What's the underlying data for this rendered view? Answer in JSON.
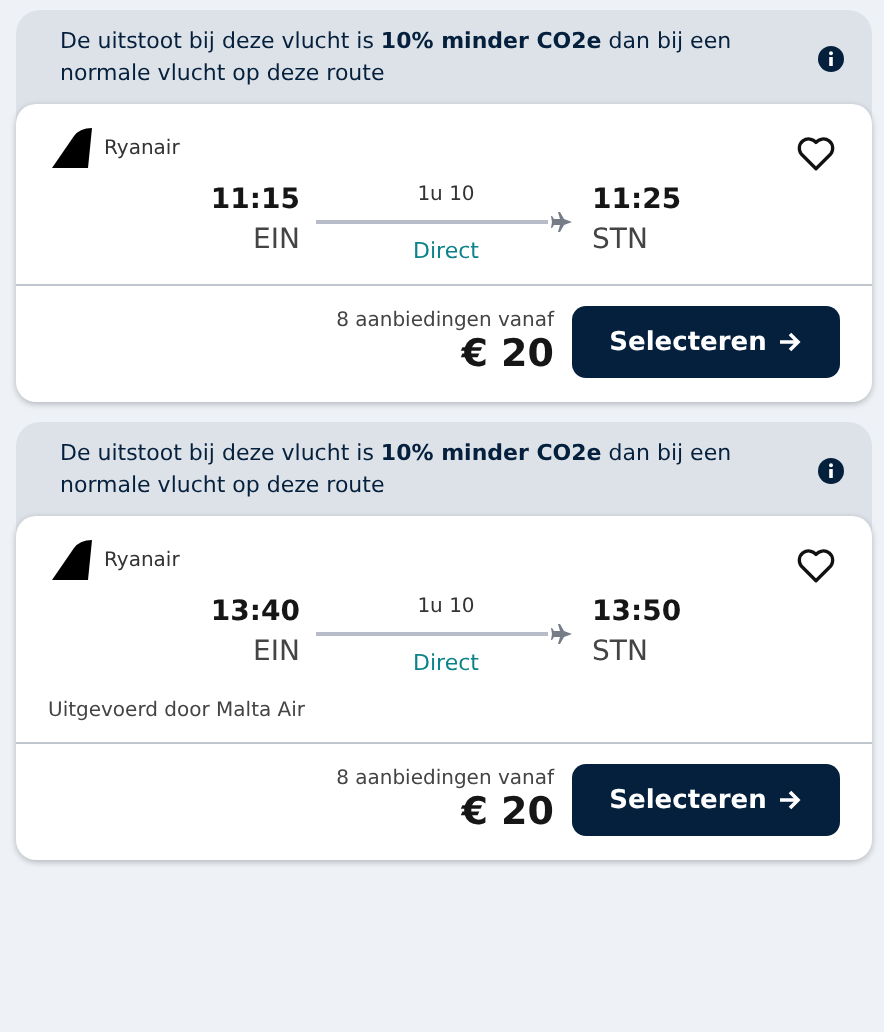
{
  "flights": [
    {
      "eco_note": "De uitstoot bij deze vlucht is **10% minder CO2e** dan bij een normale vlucht op deze route",
      "airline": "Ryanair",
      "depart_time": "11:15",
      "depart_airport": "EIN",
      "duration": "1u 10",
      "stops": "Direct",
      "arrive_time": "11:25",
      "arrive_airport": "STN",
      "offers": "8 aanbiedingen vanaf",
      "price": "€ 20",
      "button": "Selecteren"
    },
    {
      "eco_note": "De uitstoot bij deze vlucht is **10% minder CO2e** dan bij een normale vlucht op deze route",
      "airline": "Ryanair",
      "depart_time": "13:40",
      "depart_airport": "EIN",
      "duration": "1u 10",
      "stops": "Direct",
      "arrive_time": "13:50",
      "arrive_airport": "STN",
      "operated_by": "Uitgevoerd door Malta Air",
      "offers": "8 aanbiedingen vanaf",
      "price": "€ 20",
      "button": "Selecteren"
    }
  ]
}
